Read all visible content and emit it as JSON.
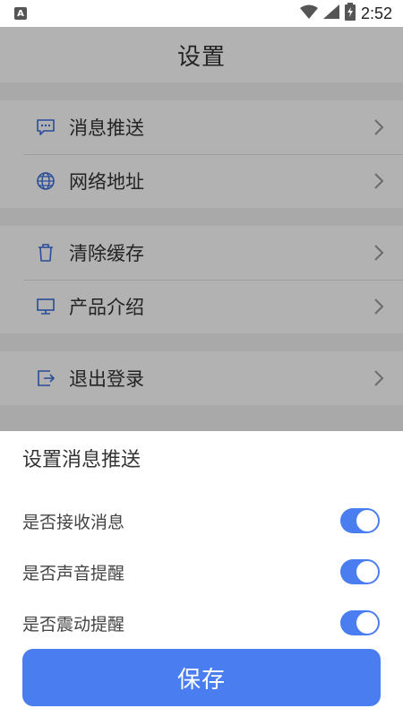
{
  "status_bar": {
    "left_badge": "A",
    "time": "2:52",
    "icons": [
      "wifi-icon",
      "signal-icon",
      "battery-charging-icon"
    ]
  },
  "page": {
    "title": "设置",
    "groups": [
      {
        "items": [
          {
            "label": "消息推送",
            "icon": "message-icon"
          },
          {
            "label": "网络地址",
            "icon": "globe-icon"
          }
        ]
      },
      {
        "items": [
          {
            "label": "清除缓存",
            "icon": "trash-icon"
          },
          {
            "label": "产品介绍",
            "icon": "monitor-icon"
          }
        ]
      },
      {
        "items": [
          {
            "label": "退出登录",
            "icon": "logout-icon"
          }
        ]
      }
    ]
  },
  "sheet": {
    "title": "设置消息推送",
    "options": [
      {
        "label": "是否接收消息",
        "enabled": true
      },
      {
        "label": "是否声音提醒",
        "enabled": true
      },
      {
        "label": "是否震动提醒",
        "enabled": true
      }
    ],
    "save_label": "保存"
  },
  "colors": {
    "accent": "#4a7df0",
    "icon": "#3b6fd8",
    "chevron": "#9a9a9a"
  }
}
